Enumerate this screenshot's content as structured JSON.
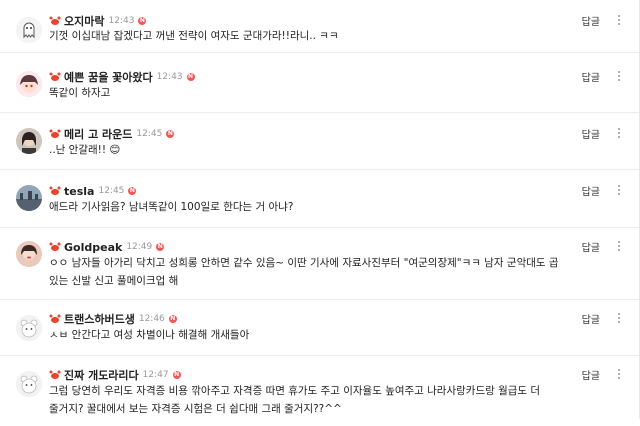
{
  "reply_label": "답글",
  "new_badge": "N",
  "comments": [
    {
      "author": "오지마락",
      "time": "12:43",
      "avatar": "ghost-avatar",
      "text": "기껏 이십대남 잡겠다고 꺼낸 전략이 여자도 군대가라!!라니.. ㅋㅋ"
    },
    {
      "author": "예쁜 꿈을 꽃아왔다",
      "time": "12:43",
      "avatar": "anime-girl-avatar",
      "text": "똑같이 하자고"
    },
    {
      "author": "메리 고 라운드",
      "time": "12:45",
      "avatar": "photo-avatar",
      "text": "..난 안갈래!! 😊"
    },
    {
      "author": "tesla",
      "time": "12:45",
      "avatar": "landscape-avatar",
      "text": "애드라 기사읽음? 남녀똑같이 100일로 한다는 거 아냐?"
    },
    {
      "author": "Goldpeak",
      "time": "12:49",
      "avatar": "woman-avatar",
      "text": "ㅇㅇ 남자들 아가리 닥치고 성희롱 안하면 같수 있음~ 이딴 기사에 자료사진부터 \"여군의장제\"ㅋㅋ 남자 군악대도 곱 있는 신발 신고 풀메이크업 해"
    },
    {
      "author": "트랜스하버드생",
      "time": "12:46",
      "avatar": "bear-avatar",
      "text": "ㅅㅂ 안간다고 여성 차별이나 해결해 개새들아"
    },
    {
      "author": "진짜 개도라리다",
      "time": "12:47",
      "avatar": "bear-avatar-2",
      "text": "그럼 당연히 우리도 자격증 비용 깎아주고 자격증 따면 휴가도 주고 이자율도 높여주고 나라사랑카드랑 월급도 더 줄거지? 꿀대에서 보는 자격증 시험은 더 쉽다매 그래 줄거지??^^"
    }
  ],
  "colors": {
    "crab": "#e8442e",
    "badge": "#f25656",
    "divider": "#ececec"
  }
}
